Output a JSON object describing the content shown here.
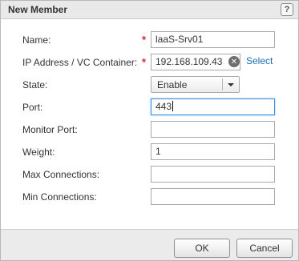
{
  "dialog": {
    "title": "New Member",
    "help_glyph": "?"
  },
  "form": {
    "name": {
      "label": "Name:",
      "required_marker": "*",
      "value": "laaS-Srv01"
    },
    "ip": {
      "label": "IP Address / VC Container:",
      "required_marker": "*",
      "value": "192.168.109.43",
      "clear_glyph": "✕",
      "select_link": "Select"
    },
    "state": {
      "label": "State:",
      "value": "Enable"
    },
    "port": {
      "label": "Port:",
      "value": "443"
    },
    "monitor_port": {
      "label": "Monitor Port:",
      "value": ""
    },
    "weight": {
      "label": "Weight:",
      "value": "1"
    },
    "max_connections": {
      "label": "Max Connections:",
      "value": ""
    },
    "min_connections": {
      "label": "Min Connections:",
      "value": ""
    }
  },
  "footer": {
    "ok_label": "OK",
    "cancel_label": "Cancel"
  },
  "colors": {
    "required": "#d9262b",
    "link": "#1a6fb3",
    "focus_border": "#3a8ee6"
  }
}
